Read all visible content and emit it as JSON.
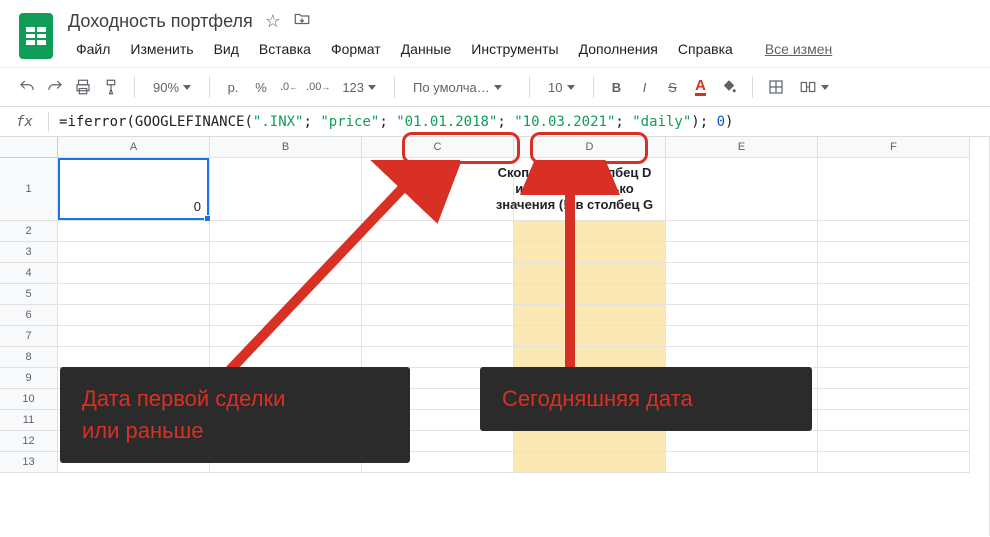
{
  "doc": {
    "title": "Доходность портфеля"
  },
  "menus": {
    "file": "Файл",
    "edit": "Изменить",
    "view": "Вид",
    "insert": "Вставка",
    "format": "Формат",
    "data": "Данные",
    "tools": "Инструменты",
    "addons": "Дополнения",
    "help": "Справка",
    "all_changes": "Все измен"
  },
  "toolbar": {
    "zoom": "90%",
    "currency": "р.",
    "percent": "%",
    "dec_dec": ".0",
    "dec_inc": ".00",
    "numfmt": "123",
    "font": "По умолча…",
    "font_size": "10",
    "bold": "B",
    "italic": "I",
    "strike": "S",
    "textcolor": "A"
  },
  "formula": {
    "fx": "fx",
    "pre": "=",
    "fn1": "iferror",
    "lp1": "(",
    "fn2": "GOOGLEFINANCE",
    "lp2": "(",
    "arg1": "\".INX\"",
    "sep": "; ",
    "arg2": "\"price\"",
    "arg3": "\"01.01.2018\"",
    "arg4": "\"10.03.2021\"",
    "arg5": "\"daily\"",
    "rp2": ")",
    "num0": "0",
    "rp1": ")"
  },
  "columns": [
    "A",
    "B",
    "C",
    "D",
    "E",
    "F"
  ],
  "rows": [
    "1",
    "2",
    "3",
    "4",
    "5",
    "6",
    "7",
    "8",
    "9",
    "10",
    "11",
    "12",
    "13"
  ],
  "cells": {
    "A1": "0",
    "D1_line1": "Скопировать столбец D",
    "D1_line2": "и вставить только",
    "D1_line3": "значения (!) в столбец G"
  },
  "annotations": {
    "callout1_l1": "Дата первой сделки",
    "callout1_l2": "или раньше",
    "callout2": "Сегодняшняя дата"
  }
}
